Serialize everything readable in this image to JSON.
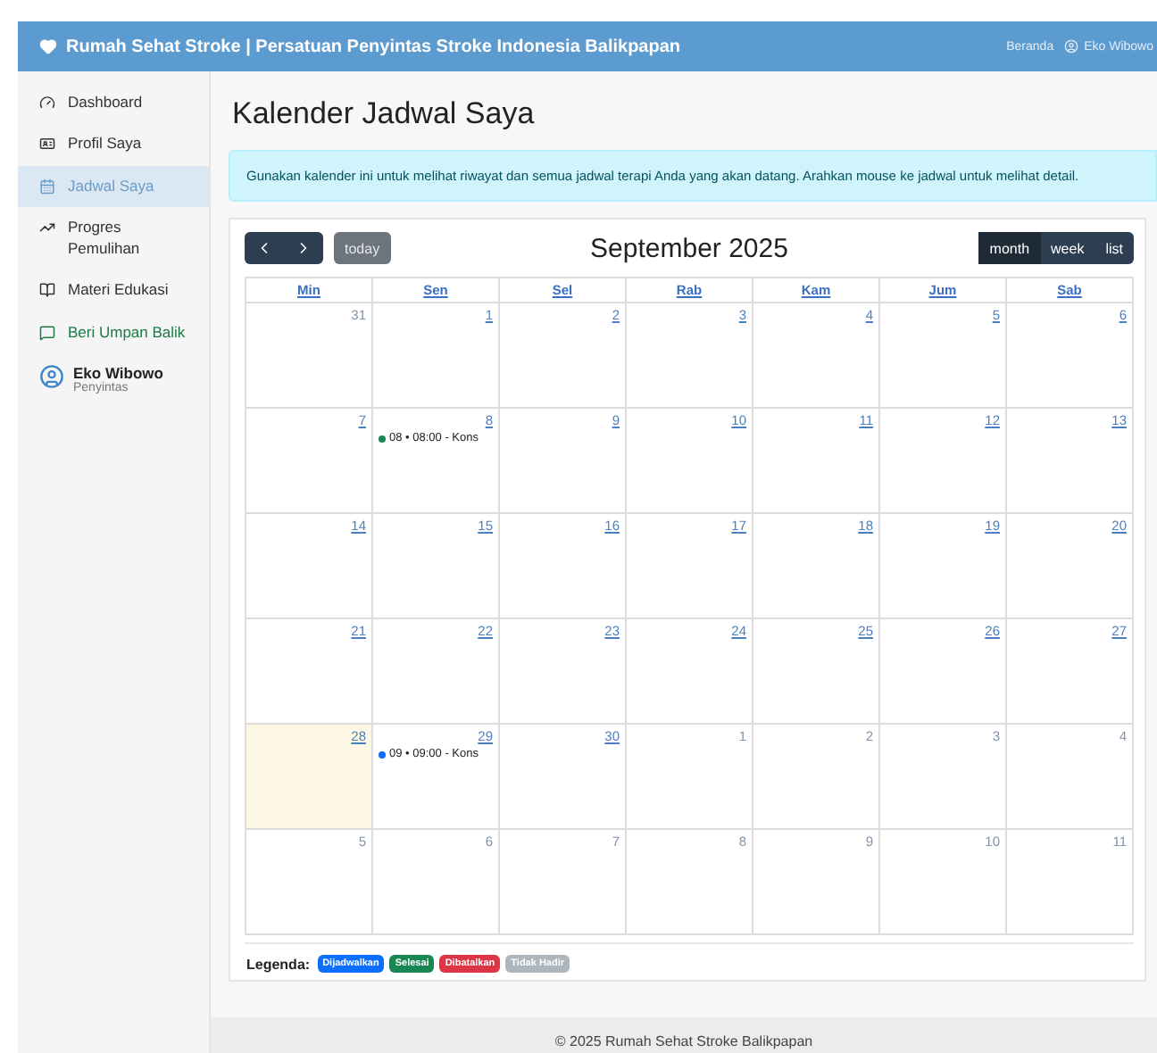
{
  "navbar": {
    "brand": "Rumah Sehat Stroke | Persatuan Penyintas Stroke Indonesia Balikpapan",
    "links": [
      "Beranda",
      "Eko Wibowo"
    ]
  },
  "sidebar": {
    "items": [
      {
        "label": "Dashboard",
        "selected": false,
        "kind": "normal"
      },
      {
        "label": "Profil Saya",
        "selected": false,
        "kind": "normal"
      },
      {
        "label": "Jadwal Saya",
        "selected": true,
        "kind": "normal"
      },
      {
        "label": "Progres Pemulihan",
        "selected": false,
        "kind": "normal"
      },
      {
        "label": "Materi Edukasi",
        "selected": false,
        "kind": "normal"
      },
      {
        "label": "Beri Umpan Balik",
        "selected": false,
        "kind": "feedback"
      }
    ],
    "user": {
      "name": "Eko Wibowo",
      "role": "Penyintas"
    }
  },
  "title": "Kalender Jadwal Saya",
  "alert": "Gunakan kalender ini untuk melihat riwayat dan semua jadwal terapi Anda yang akan datang. Arahkan mouse ke jadwal untuk melihat detail.",
  "calendar": {
    "title": "September 2025",
    "today_button": "today",
    "views": [
      {
        "label": "month",
        "selected": true
      },
      {
        "label": "week",
        "selected": false
      },
      {
        "label": "list",
        "selected": false
      }
    ],
    "weekdays": [
      "Min",
      "Sen",
      "Sel",
      "Rab",
      "Kam",
      "Jum",
      "Sab"
    ],
    "weeks": [
      [
        {
          "day": "31",
          "other_month": true,
          "today": false
        },
        {
          "day": "1",
          "other_month": false,
          "today": false
        },
        {
          "day": "2",
          "other_month": false,
          "today": false
        },
        {
          "day": "3",
          "other_month": false,
          "today": false
        },
        {
          "day": "4",
          "other_month": false,
          "today": false
        },
        {
          "day": "5",
          "other_month": false,
          "today": false
        },
        {
          "day": "6",
          "other_month": false,
          "today": false
        }
      ],
      [
        {
          "day": "7",
          "other_month": false,
          "today": false
        },
        {
          "day": "8",
          "other_month": false,
          "today": false,
          "events": [
            {
              "text": "08 • 08:00 - Kons",
              "color": "#198754"
            }
          ]
        },
        {
          "day": "9",
          "other_month": false,
          "today": false
        },
        {
          "day": "10",
          "other_month": false,
          "today": false
        },
        {
          "day": "11",
          "other_month": false,
          "today": false
        },
        {
          "day": "12",
          "other_month": false,
          "today": false
        },
        {
          "day": "13",
          "other_month": false,
          "today": false
        }
      ],
      [
        {
          "day": "14",
          "other_month": false,
          "today": false
        },
        {
          "day": "15",
          "other_month": false,
          "today": false
        },
        {
          "day": "16",
          "other_month": false,
          "today": false
        },
        {
          "day": "17",
          "other_month": false,
          "today": false
        },
        {
          "day": "18",
          "other_month": false,
          "today": false
        },
        {
          "day": "19",
          "other_month": false,
          "today": false
        },
        {
          "day": "20",
          "other_month": false,
          "today": false
        }
      ],
      [
        {
          "day": "21",
          "other_month": false,
          "today": false
        },
        {
          "day": "22",
          "other_month": false,
          "today": false
        },
        {
          "day": "23",
          "other_month": false,
          "today": false
        },
        {
          "day": "24",
          "other_month": false,
          "today": false
        },
        {
          "day": "25",
          "other_month": false,
          "today": false
        },
        {
          "day": "26",
          "other_month": false,
          "today": false
        },
        {
          "day": "27",
          "other_month": false,
          "today": false
        }
      ],
      [
        {
          "day": "28",
          "other_month": false,
          "today": true
        },
        {
          "day": "29",
          "other_month": false,
          "today": false,
          "events": [
            {
              "text": "09 • 09:00 - Kons",
              "color": "#0d6efd"
            }
          ]
        },
        {
          "day": "30",
          "other_month": false,
          "today": false
        },
        {
          "day": "1",
          "other_month": true,
          "today": false
        },
        {
          "day": "2",
          "other_month": true,
          "today": false
        },
        {
          "day": "3",
          "other_month": true,
          "today": false
        },
        {
          "day": "4",
          "other_month": true,
          "today": false
        }
      ],
      [
        {
          "day": "5",
          "other_month": true,
          "today": false
        },
        {
          "day": "6",
          "other_month": true,
          "today": false
        },
        {
          "day": "7",
          "other_month": true,
          "today": false
        },
        {
          "day": "8",
          "other_month": true,
          "today": false
        },
        {
          "day": "9",
          "other_month": true,
          "today": false
        },
        {
          "day": "10",
          "other_month": true,
          "today": false
        },
        {
          "day": "11",
          "other_month": true,
          "today": false
        }
      ]
    ]
  },
  "legend": {
    "label": "Legenda:",
    "items": [
      {
        "label": "Dijadwalkan",
        "color": "#0d6efd"
      },
      {
        "label": "Selesai",
        "color": "#198754"
      },
      {
        "label": "Dibatalkan",
        "color": "#dc3545"
      },
      {
        "label": "Tidak Hadir",
        "color": "#adb5bd"
      }
    ]
  },
  "footer": "© 2025 Rumah Sehat Stroke Balikpapan"
}
